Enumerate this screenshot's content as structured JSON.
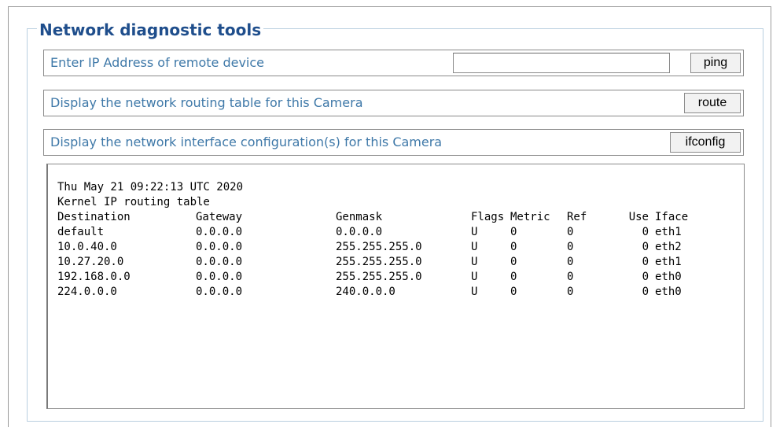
{
  "section": {
    "title": "Network diagnostic tools"
  },
  "ping_row": {
    "label": "Enter IP Address of remote device",
    "input_value": "",
    "button_label": "ping"
  },
  "route_row": {
    "label": "Display the network routing table for this Camera",
    "button_label": "route"
  },
  "ifconfig_row": {
    "label": "Display the network interface configuration(s) for this Camera",
    "button_label": "ifconfig"
  },
  "output": {
    "timestamp": "Thu May 21 09:22:13 UTC 2020",
    "heading": "Kernel IP routing table",
    "columns": [
      "Destination",
      "Gateway",
      "Genmask",
      "Flags",
      "Metric",
      "Ref",
      "Use",
      "Iface"
    ],
    "rows": [
      [
        "default",
        "0.0.0.0",
        "0.0.0.0",
        "U",
        "0",
        "0",
        "0",
        "eth1"
      ],
      [
        "10.0.40.0",
        "0.0.0.0",
        "255.255.255.0",
        "U",
        "0",
        "0",
        "0",
        "eth2"
      ],
      [
        "10.27.20.0",
        "0.0.0.0",
        "255.255.255.0",
        "U",
        "0",
        "0",
        "0",
        "eth1"
      ],
      [
        "192.168.0.0",
        "0.0.0.0",
        "255.255.255.0",
        "U",
        "0",
        "0",
        "0",
        "eth0"
      ],
      [
        "224.0.0.0",
        "0.0.0.0",
        "240.0.0.0",
        "U",
        "0",
        "0",
        "0",
        "eth0"
      ]
    ]
  }
}
